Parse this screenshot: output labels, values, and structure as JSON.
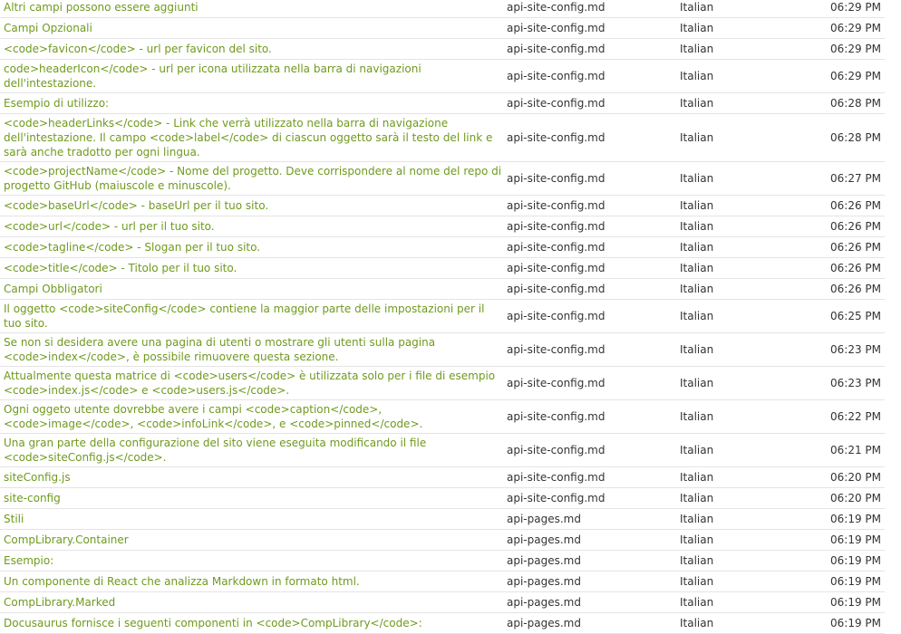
{
  "rows": [
    {
      "text": "Altri campi possono essere aggiunti",
      "file": "api-site-config.md",
      "language": "Italian",
      "time": "06:29 PM"
    },
    {
      "text": "Campi Opzionali",
      "file": "api-site-config.md",
      "language": "Italian",
      "time": "06:29 PM"
    },
    {
      "text": "<code>favicon</code> - url per favicon del sito.",
      "file": "api-site-config.md",
      "language": "Italian",
      "time": "06:29 PM"
    },
    {
      "text": "code>headerIcon</code> - url per icona utilizzata nella barra di navigazioni dell'intestazione.",
      "file": "api-site-config.md",
      "language": "Italian",
      "time": "06:29 PM"
    },
    {
      "text": "Esempio di utilizzo:",
      "file": "api-site-config.md",
      "language": "Italian",
      "time": "06:28 PM"
    },
    {
      "text": "<code>headerLinks</code> - Link che verrà utilizzato nella barra di navigazione dell'intestazione. Il campo <code>label</code> di ciascun oggetto sarà il testo del link e sarà anche tradotto per ogni lingua.",
      "file": "api-site-config.md",
      "language": "Italian",
      "time": "06:28 PM"
    },
    {
      "text": "<code>projectName</code> - Nome del progetto. Deve corrispondere al nome del repo di progetto GitHub (maiuscole e minuscole).",
      "file": "api-site-config.md",
      "language": "Italian",
      "time": "06:27 PM"
    },
    {
      "text": "<code>baseUrl</code> - baseUrl per il tuo sito.",
      "file": "api-site-config.md",
      "language": "Italian",
      "time": "06:26 PM"
    },
    {
      "text": "<code>url</code> - url per il tuo sito.",
      "file": "api-site-config.md",
      "language": "Italian",
      "time": "06:26 PM"
    },
    {
      "text": "<code>tagline</code> - Slogan per il tuo sito.",
      "file": "api-site-config.md",
      "language": "Italian",
      "time": "06:26 PM"
    },
    {
      "text": "<code>title</code> - Titolo per il tuo sito.",
      "file": "api-site-config.md",
      "language": "Italian",
      "time": "06:26 PM"
    },
    {
      "text": "Campi Obbligatori",
      "file": "api-site-config.md",
      "language": "Italian",
      "time": "06:26 PM"
    },
    {
      "text": "Il oggetto <code>siteConfig</code> contiene la maggior parte delle impostazioni per il tuo sito.",
      "file": "api-site-config.md",
      "language": "Italian",
      "time": "06:25 PM"
    },
    {
      "text": "Se non si desidera avere una pagina di utenti o mostrare gli utenti sulla pagina <code>index</code>, è possibile rimuovere questa sezione.",
      "file": "api-site-config.md",
      "language": "Italian",
      "time": "06:23 PM"
    },
    {
      "text": "Attualmente questa matrice di <code>users</code> è utilizzata solo per i file di esempio <code>index.js</code> e <code>users.js</code>.",
      "file": "api-site-config.md",
      "language": "Italian",
      "time": "06:23 PM"
    },
    {
      "text": "Ogni oggeto utente dovrebbe avere i campi <code>caption</code>, <code>image</code>, <code>infoLink</code>, e <code>pinned</code>.",
      "file": "api-site-config.md",
      "language": "Italian",
      "time": "06:22 PM"
    },
    {
      "text": "Una gran parte della configurazione del sito viene eseguita modificando il file <code>siteConfig.js</code>.",
      "file": "api-site-config.md",
      "language": "Italian",
      "time": "06:21 PM"
    },
    {
      "text": "siteConfig.js",
      "file": "api-site-config.md",
      "language": "Italian",
      "time": "06:20 PM"
    },
    {
      "text": "site-config",
      "file": "api-site-config.md",
      "language": "Italian",
      "time": "06:20 PM"
    },
    {
      "text": "Stili",
      "file": "api-pages.md",
      "language": "Italian",
      "time": "06:19 PM"
    },
    {
      "text": "CompLibrary.Container",
      "file": "api-pages.md",
      "language": "Italian",
      "time": "06:19 PM"
    },
    {
      "text": "Esempio:",
      "file": "api-pages.md",
      "language": "Italian",
      "time": "06:19 PM"
    },
    {
      "text": "Un componente di React che analizza Markdown in formato html.",
      "file": "api-pages.md",
      "language": "Italian",
      "time": "06:19 PM"
    },
    {
      "text": "CompLibrary.Marked",
      "file": "api-pages.md",
      "language": "Italian",
      "time": "06:19 PM"
    },
    {
      "text": "Docusaurus fornisce i seguenti componenti in <code>CompLibrary</code>:",
      "file": "api-pages.md",
      "language": "Italian",
      "time": "06:19 PM"
    }
  ]
}
